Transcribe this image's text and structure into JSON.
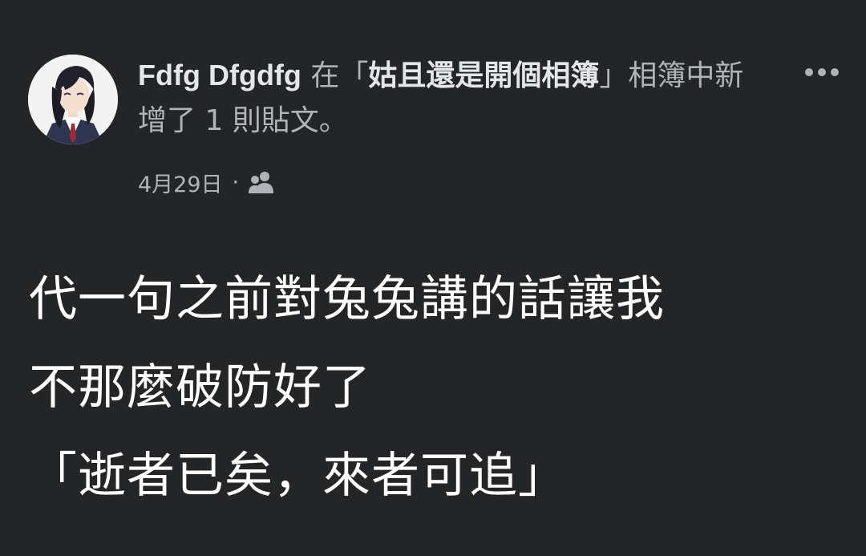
{
  "post": {
    "author_name": "Fdfg Dfgdfg",
    "action_prefix": " 在「",
    "album_name": "姑且還是開個相簿",
    "action_suffix": "」相簿中新增了 1 則貼文。",
    "timestamp": "4月29日",
    "meta_separator": "·",
    "audience_icon": "friends-icon",
    "more_icon": "more-horizontal-icon",
    "body_lines": [
      "代一句之前對兔兔講的話讓我",
      "不那麼破防好了",
      "「逝者已矣，來者可追」"
    ]
  },
  "colors": {
    "background": "#242526",
    "primary_text": "#e4e6eb",
    "secondary_text": "#b0b3b8",
    "body_text": "#ffffff"
  }
}
